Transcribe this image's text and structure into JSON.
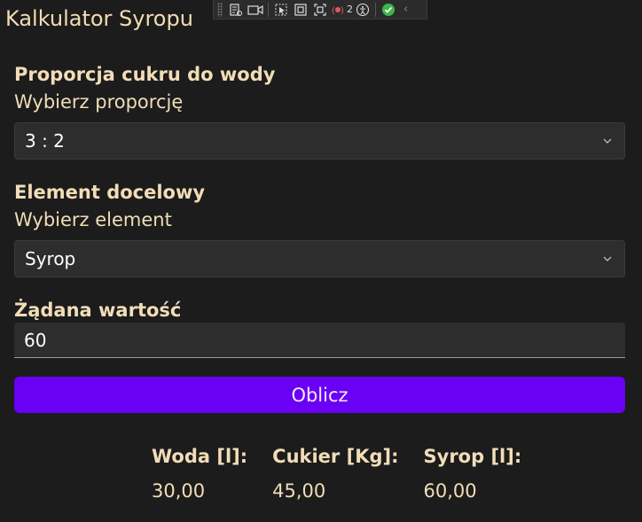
{
  "app": {
    "title": "Kalkulator Syropu"
  },
  "toolbar": {
    "live_tree_badge": "2"
  },
  "ratio": {
    "label": "Proporcja cukru do wody",
    "sublabel": "Wybierz proporcję",
    "selected": "3 : 2"
  },
  "target": {
    "label": "Element docelowy",
    "sublabel": "Wybierz element",
    "selected": "Syrop"
  },
  "amount": {
    "label": "Żądana wartość",
    "value": "60"
  },
  "calculate": {
    "label": "Oblicz"
  },
  "results": [
    {
      "heading": "Woda [l]:",
      "value": "30,00"
    },
    {
      "heading": "Cukier [Kg]:",
      "value": "45,00"
    },
    {
      "heading": "Syrop [l]:",
      "value": "60,00"
    }
  ],
  "colors": {
    "background": "#1c1c1c",
    "text": "#f1ddb7",
    "accent": "#6a00f4",
    "field": "#2d2d2d"
  }
}
